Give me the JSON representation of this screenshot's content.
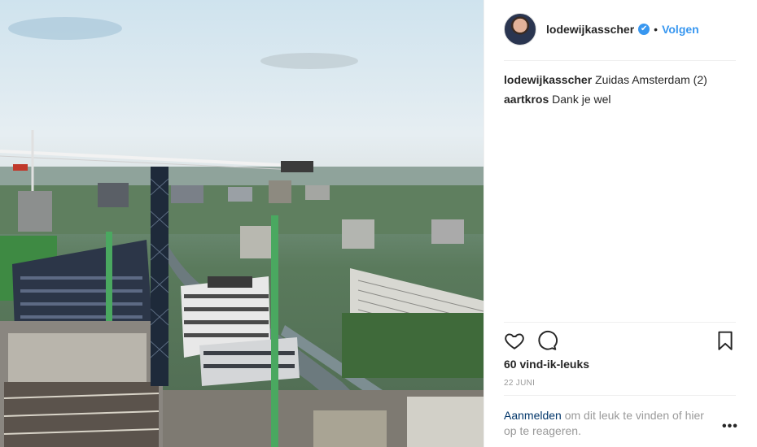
{
  "post": {
    "image_alt": "",
    "author": {
      "username": "lodewijkasscher",
      "verified_glyph": "✔",
      "separator": "•",
      "follow_label": "Volgen"
    },
    "comments": [
      {
        "user": "lodewijkasscher",
        "text": "Zuidas Amsterdam (2)"
      },
      {
        "user": "aartkros",
        "text": "Dank je wel"
      }
    ],
    "icons": {
      "like": "heart-icon",
      "comment": "comment-icon",
      "save": "bookmark-icon",
      "options": "more-options-icon"
    },
    "likes_text": "60 vind-ik-leuks",
    "date_text": "22 JUNI",
    "login_prompt": {
      "link_label": "Aanmelden",
      "text": " om dit leuk te vinden of hier op te reageren."
    },
    "more_options_label": "•••"
  },
  "colors": {
    "accent": "#3897f0",
    "link_dark": "#003569",
    "muted": "#999999",
    "text": "#262626"
  }
}
